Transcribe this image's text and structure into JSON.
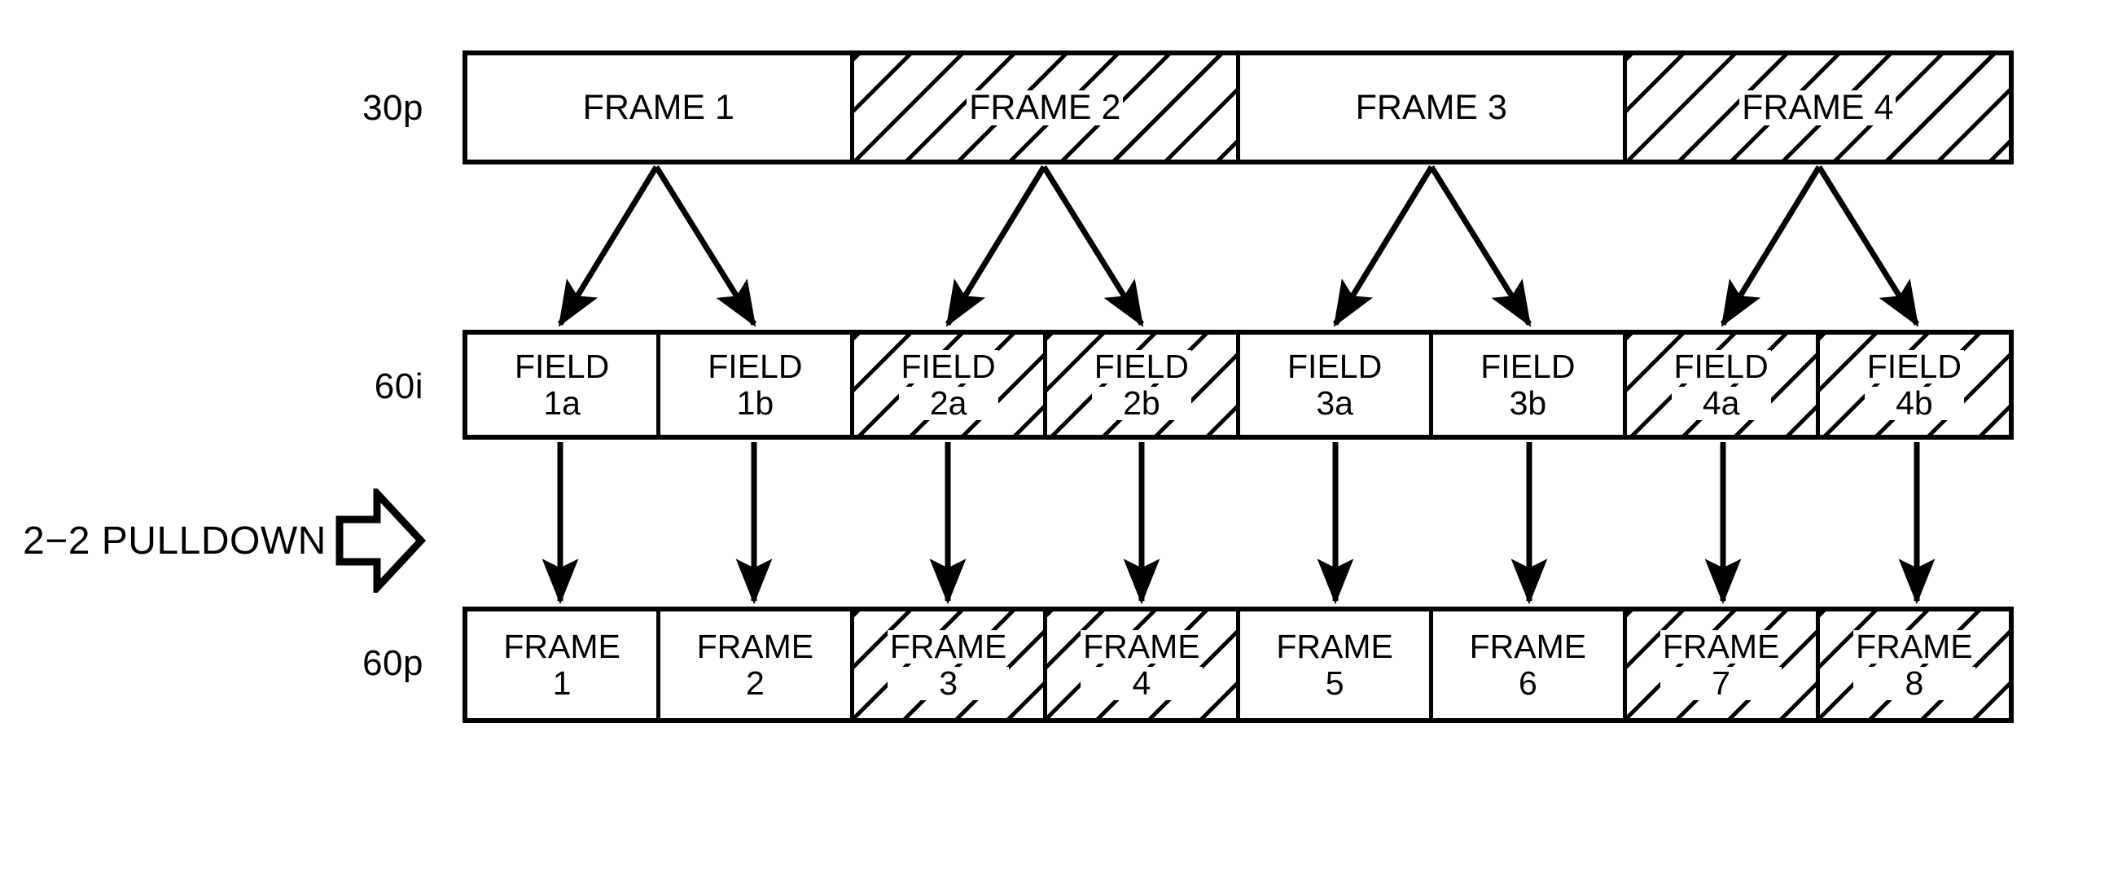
{
  "diagram": {
    "title_text": "2-2 PULLDOWN frame/field conversion diagram",
    "pulldown_label": "2−2 PULLDOWN",
    "pulldown_arrow_icon": "block-arrow-right-icon",
    "line_color": "#000000",
    "background_color": "#ffffff",
    "hatch_color": "#000000",
    "rows": [
      {
        "id": "row-30p",
        "label": "30p",
        "cells": [
          {
            "line1": "FRAME 1",
            "line2": "",
            "hatched": false
          },
          {
            "line1": "FRAME 2",
            "line2": "",
            "hatched": true
          },
          {
            "line1": "FRAME 3",
            "line2": "",
            "hatched": false
          },
          {
            "line1": "FRAME 4",
            "line2": "",
            "hatched": true
          }
        ]
      },
      {
        "id": "row-60i",
        "label": "60i",
        "cells": [
          {
            "line1": "FIELD",
            "line2": "1a",
            "hatched": false
          },
          {
            "line1": "FIELD",
            "line2": "1b",
            "hatched": false
          },
          {
            "line1": "FIELD",
            "line2": "2a",
            "hatched": true
          },
          {
            "line1": "FIELD",
            "line2": "2b",
            "hatched": true
          },
          {
            "line1": "FIELD",
            "line2": "3a",
            "hatched": false
          },
          {
            "line1": "FIELD",
            "line2": "3b",
            "hatched": false
          },
          {
            "line1": "FIELD",
            "line2": "4a",
            "hatched": true
          },
          {
            "line1": "FIELD",
            "line2": "4b",
            "hatched": true
          }
        ]
      },
      {
        "id": "row-60p",
        "label": "60p",
        "cells": [
          {
            "line1": "FRAME",
            "line2": "1",
            "hatched": false
          },
          {
            "line1": "FRAME",
            "line2": "2",
            "hatched": false
          },
          {
            "line1": "FRAME",
            "line2": "3",
            "hatched": true
          },
          {
            "line1": "FRAME",
            "line2": "4",
            "hatched": true
          },
          {
            "line1": "FRAME",
            "line2": "5",
            "hatched": false
          },
          {
            "line1": "FRAME",
            "line2": "6",
            "hatched": false
          },
          {
            "line1": "FRAME",
            "line2": "7",
            "hatched": true
          },
          {
            "line1": "FRAME",
            "line2": "8",
            "hatched": true
          }
        ]
      }
    ],
    "connections": {
      "frame_to_field": [
        {
          "from": "FRAME 1",
          "to": [
            "FIELD 1a",
            "FIELD 1b"
          ]
        },
        {
          "from": "FRAME 2",
          "to": [
            "FIELD 2a",
            "FIELD 2b"
          ]
        },
        {
          "from": "FRAME 3",
          "to": [
            "FIELD 3a",
            "FIELD 3b"
          ]
        },
        {
          "from": "FRAME 4",
          "to": [
            "FIELD 4a",
            "FIELD 4b"
          ]
        }
      ],
      "field_to_frame": [
        {
          "from": "FIELD 1a",
          "to": "FRAME 1"
        },
        {
          "from": "FIELD 1b",
          "to": "FRAME 2"
        },
        {
          "from": "FIELD 2a",
          "to": "FRAME 3"
        },
        {
          "from": "FIELD 2b",
          "to": "FRAME 4"
        },
        {
          "from": "FIELD 3a",
          "to": "FRAME 5"
        },
        {
          "from": "FIELD 3b",
          "to": "FRAME 6"
        },
        {
          "from": "FIELD 4a",
          "to": "FRAME 7"
        },
        {
          "from": "FIELD 4b",
          "to": "FRAME 8"
        }
      ]
    }
  }
}
